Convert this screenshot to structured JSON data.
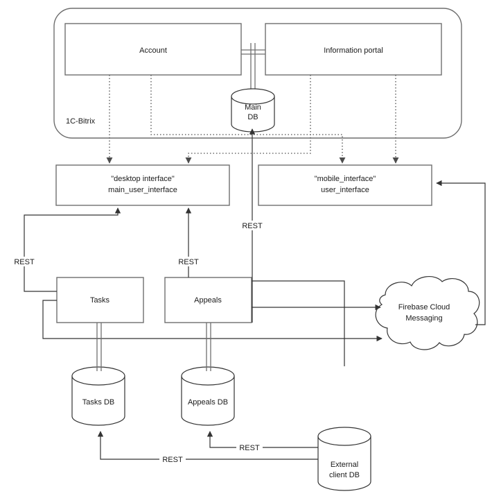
{
  "diagram": {
    "title": "System architecture diagram",
    "colors": {
      "background": "#ffffff",
      "shape_stroke": "#6e6e6e",
      "edge_stroke": "#333333",
      "dotted_edge": "#4d4d4d",
      "text": "#1a1a1a"
    },
    "container": {
      "label": "1C-Bitrix",
      "shape": "rounded-rectangle"
    },
    "nodes": [
      {
        "id": "account",
        "label": "Account",
        "shape": "rectangle"
      },
      {
        "id": "information-portal",
        "label": "Information portal",
        "shape": "rectangle"
      },
      {
        "id": "main-db",
        "label": "Main\nDB",
        "line1": "Main",
        "line2": "DB",
        "shape": "cylinder"
      },
      {
        "id": "desktop-interface",
        "label": "\"desktop interface\" main_user_interface",
        "line1": "\"desktop interface\"",
        "line2": "main_user_interface",
        "shape": "rectangle"
      },
      {
        "id": "mobile-interface",
        "label": "\"mobile_interface\" user_interface",
        "line1": "\"mobile_interface\"",
        "line2": "user_interface",
        "shape": "rectangle"
      },
      {
        "id": "tasks",
        "label": "Tasks",
        "shape": "rectangle"
      },
      {
        "id": "appeals",
        "label": "Appeals",
        "shape": "rectangle"
      },
      {
        "id": "firebase",
        "label": "Firebase Cloud Messaging",
        "line1": "Firebase Cloud",
        "line2": "Messaging",
        "shape": "cloud"
      },
      {
        "id": "tasks-db",
        "label": "Tasks DB",
        "shape": "cylinder"
      },
      {
        "id": "appeals-db",
        "label": "Appeals DB",
        "shape": "cylinder"
      },
      {
        "id": "external-client-db",
        "label": "External client DB",
        "line1": "External",
        "line2": "client DB",
        "shape": "cylinder"
      }
    ],
    "edge_labels": [
      {
        "id": "rest-tasks-desktop",
        "text": "REST"
      },
      {
        "id": "rest-appeals-desktop",
        "text": "REST"
      },
      {
        "id": "rest-appeals-maindb",
        "text": "REST"
      },
      {
        "id": "rest-extdb-appealsdb",
        "text": "REST"
      },
      {
        "id": "rest-extdb-tasksdb",
        "text": "REST"
      }
    ]
  }
}
